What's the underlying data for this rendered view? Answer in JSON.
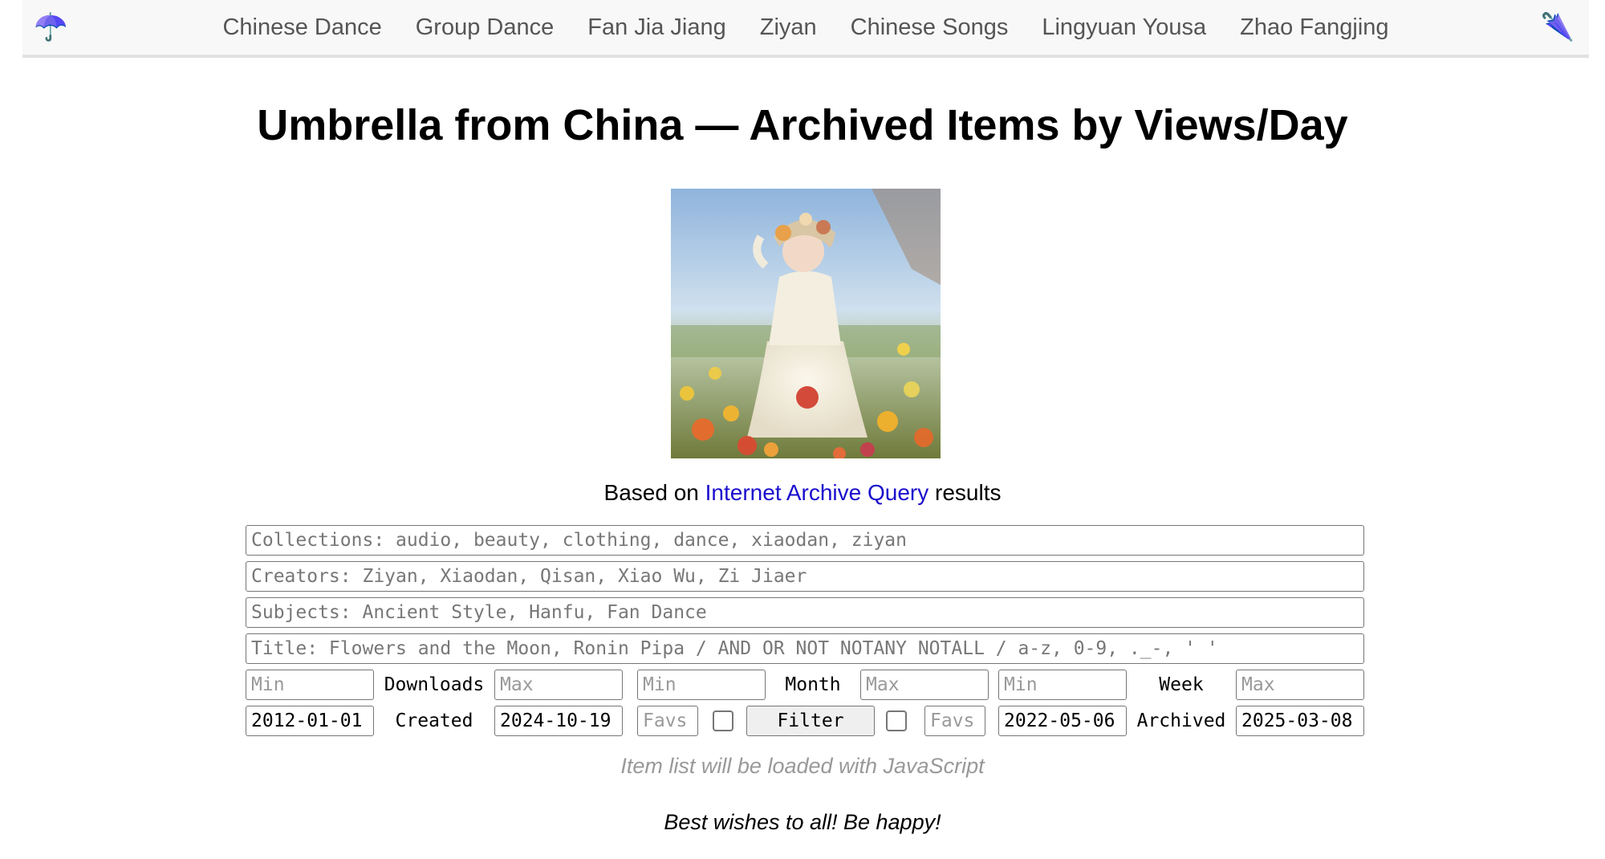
{
  "nav": {
    "logo_left": "☂️",
    "logo_right": "🌂",
    "links": [
      "Chinese Dance",
      "Group Dance",
      "Fan Jia Jiang",
      "Ziyan",
      "Chinese Songs",
      "Lingyuan Yousa",
      "Zhao Fangjing"
    ]
  },
  "page": {
    "title": "Umbrella from China — Archived Items by Views/Day",
    "query_prefix": "Based on",
    "query_link": "Internet Archive Query",
    "query_suffix": "results",
    "loading_text": "Item list will be loaded with JavaScript",
    "footer_text": "Best wishes to all! Be happy!"
  },
  "filters": {
    "collections_placeholder": "Collections: audio, beauty, clothing, dance, xiaodan, ziyan",
    "creators_placeholder": "Creators: Ziyan, Xiaodan, Qisan, Xiao Wu, Zi Jiaer",
    "subjects_placeholder": "Subjects: Ancient Style, Hanfu, Fan Dance",
    "title_placeholder": "Title: Flowers and the Moon, Ronin Pipa / AND OR NOT NOTANY NOTALL / a-z, 0-9, ._-, ' '",
    "min_placeholder": "Min",
    "max_placeholder": "Max",
    "downloads_label": "Downloads",
    "month_label": "Month",
    "week_label": "Week",
    "created_label": "Created",
    "archived_label": "Archived",
    "created_from": "2012-01-01",
    "created_to": "2024-10-19",
    "archived_from": "2022-05-06",
    "archived_to": "2025-03-08",
    "favs_placeholder": "Favs",
    "filter_label": "Filter"
  }
}
